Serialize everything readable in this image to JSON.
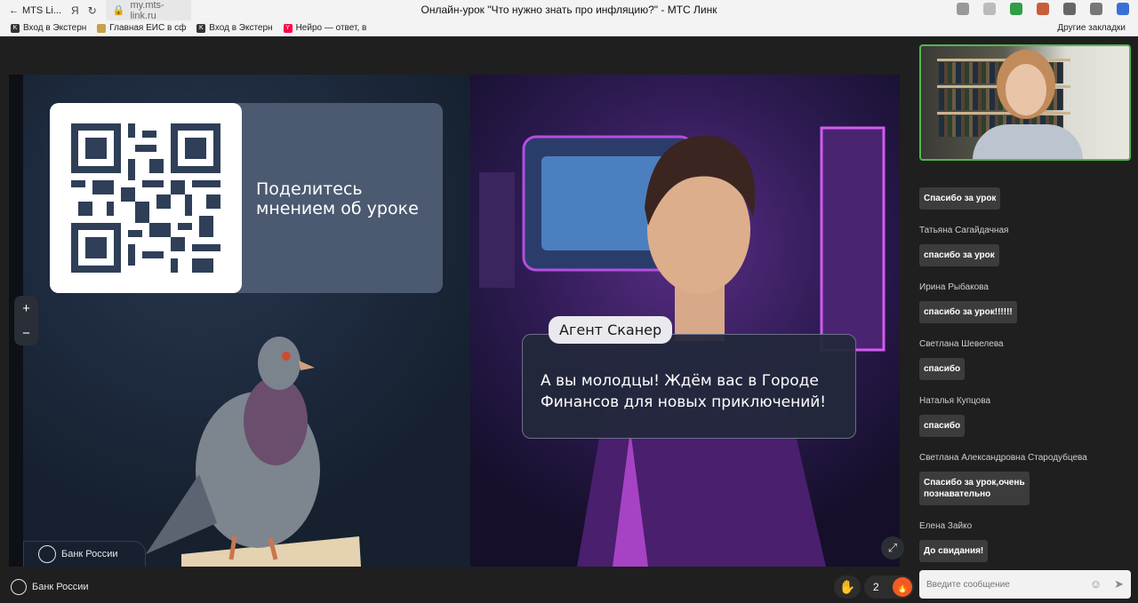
{
  "browser": {
    "tab_title": "MTS Li...",
    "url": "my.mts-link.ru",
    "page_title": "Онлайн-урок \"Что нужно знать про инфляцию?\" - МТС Линк",
    "bookmarks": [
      "Вход в Экстерн",
      "Главная ЕИС в сф",
      "Вход в Экстерн",
      "Нейро — ответ, в"
    ],
    "other_bookmarks": "Другие закладки"
  },
  "slide": {
    "qr_caption_line1": "Поделитесь",
    "qr_caption_line2": "мнением об уроке",
    "bank_badge": "Банк России",
    "agent_name": "Агент Сканер",
    "speech_text": "А вы молодцы! Ждём вас в Городе Финансов для новых приключений!",
    "zoom_in": "+",
    "zoom_out": "−",
    "expand_icon": "⤢"
  },
  "chat": {
    "messages": [
      {
        "author": "",
        "text": "Спасибо за урок"
      },
      {
        "author": "Татьяна Сагайдачная",
        "text": "спасибо за урок"
      },
      {
        "author": "Ирина Рыбакова",
        "text": "спасибо за урок!!!!!!"
      },
      {
        "author": "Светлана Шевелева",
        "text": "спасибо"
      },
      {
        "author": "Наталья Купцова",
        "text": "спасибо"
      },
      {
        "author": "Светлана Александровна Стародубцева",
        "text": "Спасибо за урок,очень познавательно"
      },
      {
        "author": "Елена Зайко",
        "text": "До свидания!"
      }
    ],
    "input_placeholder": "Введите сообщение"
  },
  "bottom": {
    "bank_label": "Банк России",
    "reaction_count": "2"
  }
}
